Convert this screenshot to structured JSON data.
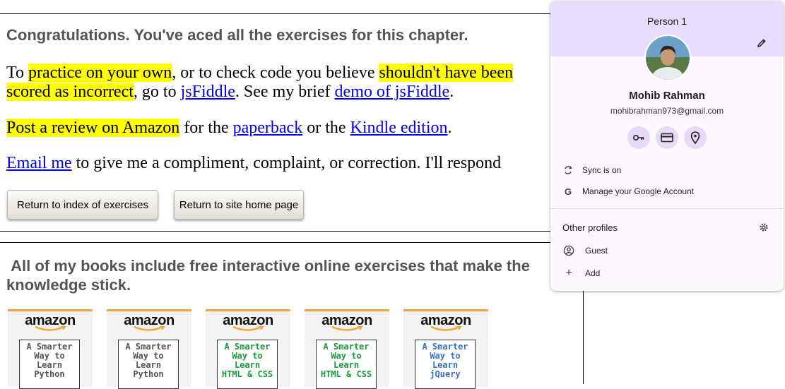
{
  "main": {
    "congrats": "Congratulations. You've aced all the exercises for this chapter.",
    "p1": {
      "a": "To ",
      "b": "practice on your own",
      "c": ", or to check code you believe ",
      "d": "shouldn't have been",
      "e": "scored as incorrect",
      "f": ", go to ",
      "g": "jsFiddle",
      "h": ". See my brief ",
      "i": "demo of jsFiddle",
      "j": "."
    },
    "p2": {
      "a": "Post a review on Amazon",
      "b": " for the ",
      "c": "paperback",
      "d": " or the ",
      "e": "Kindle edition",
      "f": "."
    },
    "p3": {
      "a": "Email me",
      "b": " to give me a compliment, complaint, or correction. I'll respond"
    },
    "buttons": {
      "return_index": "Return to index of exercises",
      "return_home": "Return to site home page"
    },
    "books_heading": "All of my books include free interactive online exercises that make the knowledge stick."
  },
  "books": [
    {
      "brand": "amazon",
      "l1": "A Smarter",
      "l2": "Way to",
      "l3": "Learn",
      "l4": "Python",
      "color": "#555555"
    },
    {
      "brand": "amazon",
      "l1": "A Smarter",
      "l2": "Way to",
      "l3": "Learn",
      "l4": "Python",
      "color": "#555555"
    },
    {
      "brand": "amazon",
      "l1": "A Smarter",
      "l2": "Way to",
      "l3": "Learn",
      "l4": "HTML & CSS",
      "color": "#1a9a3c"
    },
    {
      "brand": "amazon",
      "l1": "A Smarter",
      "l2": "Way to",
      "l3": "Learn",
      "l4": "HTML & CSS",
      "color": "#1a9a3c"
    },
    {
      "brand": "amazon",
      "l1": "A Smarter",
      "l2": "Way to",
      "l3": "Learn",
      "l4": "jQuery",
      "color": "#3b6fc4"
    }
  ],
  "profile": {
    "person": "Person 1",
    "name": "Mohib Rahman",
    "email": "mohibrahman973@gmail.com",
    "sync": "Sync is on",
    "manage": "Manage your Google Account",
    "other_profiles": "Other profiles",
    "guest": "Guest",
    "add": "Add"
  },
  "colors": {
    "highlight": "#ffff00",
    "link": "#0000ee",
    "panel_header": "#e9ddff",
    "amazon_orange": "#f3a633"
  }
}
